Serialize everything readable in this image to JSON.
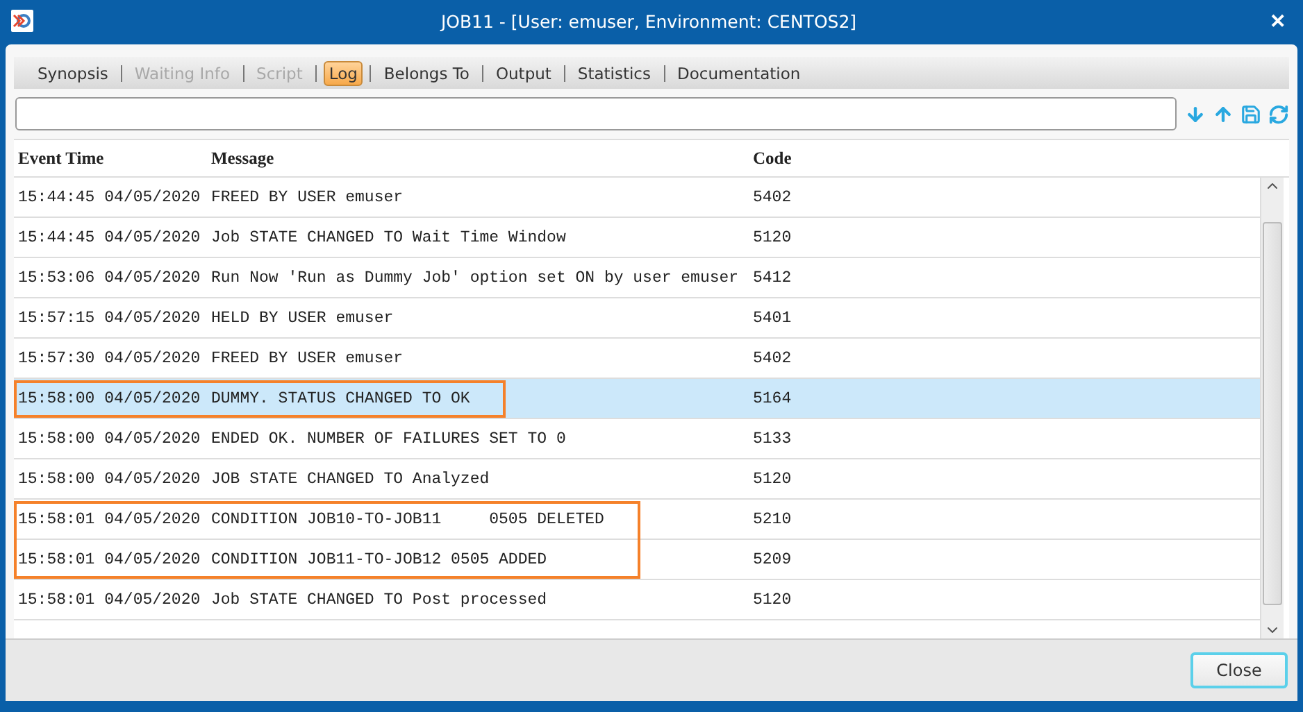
{
  "window": {
    "title": "JOB11 - [User: emuser, Environment: CENTOS2]",
    "close": "✕"
  },
  "tabs": [
    {
      "label": "Synopsis",
      "selected": false,
      "disabled": false
    },
    {
      "label": "Waiting Info",
      "selected": false,
      "disabled": true
    },
    {
      "label": "Script",
      "selected": false,
      "disabled": true
    },
    {
      "label": "Log",
      "selected": true,
      "disabled": false
    },
    {
      "label": "Belongs To",
      "selected": false,
      "disabled": false
    },
    {
      "label": "Output",
      "selected": false,
      "disabled": false
    },
    {
      "label": "Statistics",
      "selected": false,
      "disabled": false
    },
    {
      "label": "Documentation",
      "selected": false,
      "disabled": false
    }
  ],
  "table": {
    "columns": [
      "Event Time",
      "Message",
      "Code"
    ],
    "rows": [
      {
        "time": "15:44:45 04/05/2020",
        "message": "FREED BY USER emuser",
        "code": "5402",
        "selected": false,
        "marked": false
      },
      {
        "time": "15:44:45 04/05/2020",
        "message": "Job STATE CHANGED TO Wait Time Window",
        "code": "5120",
        "selected": false,
        "marked": false
      },
      {
        "time": "15:53:06 04/05/2020",
        "message": "Run Now 'Run as Dummy Job' option set ON by user emuser",
        "code": "5412",
        "selected": false,
        "marked": false
      },
      {
        "time": "15:57:15 04/05/2020",
        "message": "HELD BY USER emuser",
        "code": "5401",
        "selected": false,
        "marked": false
      },
      {
        "time": "15:57:30 04/05/2020",
        "message": "FREED BY USER emuser",
        "code": "5402",
        "selected": false,
        "marked": false
      },
      {
        "time": "15:58:00 04/05/2020",
        "message": "DUMMY. STATUS CHANGED TO OK",
        "code": "5164",
        "selected": true,
        "marked": true
      },
      {
        "time": "15:58:00 04/05/2020",
        "message": "ENDED OK. NUMBER OF FAILURES SET TO 0",
        "code": "5133",
        "selected": false,
        "marked": false
      },
      {
        "time": "15:58:00 04/05/2020",
        "message": "JOB STATE CHANGED TO Analyzed",
        "code": "5120",
        "selected": false,
        "marked": false
      },
      {
        "time": "15:58:01 04/05/2020",
        "message": "CONDITION JOB10-TO-JOB11     0505 DELETED",
        "code": "5210",
        "selected": false,
        "marked": true
      },
      {
        "time": "15:58:01 04/05/2020",
        "message": "CONDITION JOB11-TO-JOB12 0505 ADDED",
        "code": "5209",
        "selected": false,
        "marked": true
      },
      {
        "time": "15:58:01 04/05/2020",
        "message": "Job STATE CHANGED TO Post processed",
        "code": "5120",
        "selected": false,
        "marked": false
      }
    ]
  },
  "buttons": [
    "Close"
  ]
}
